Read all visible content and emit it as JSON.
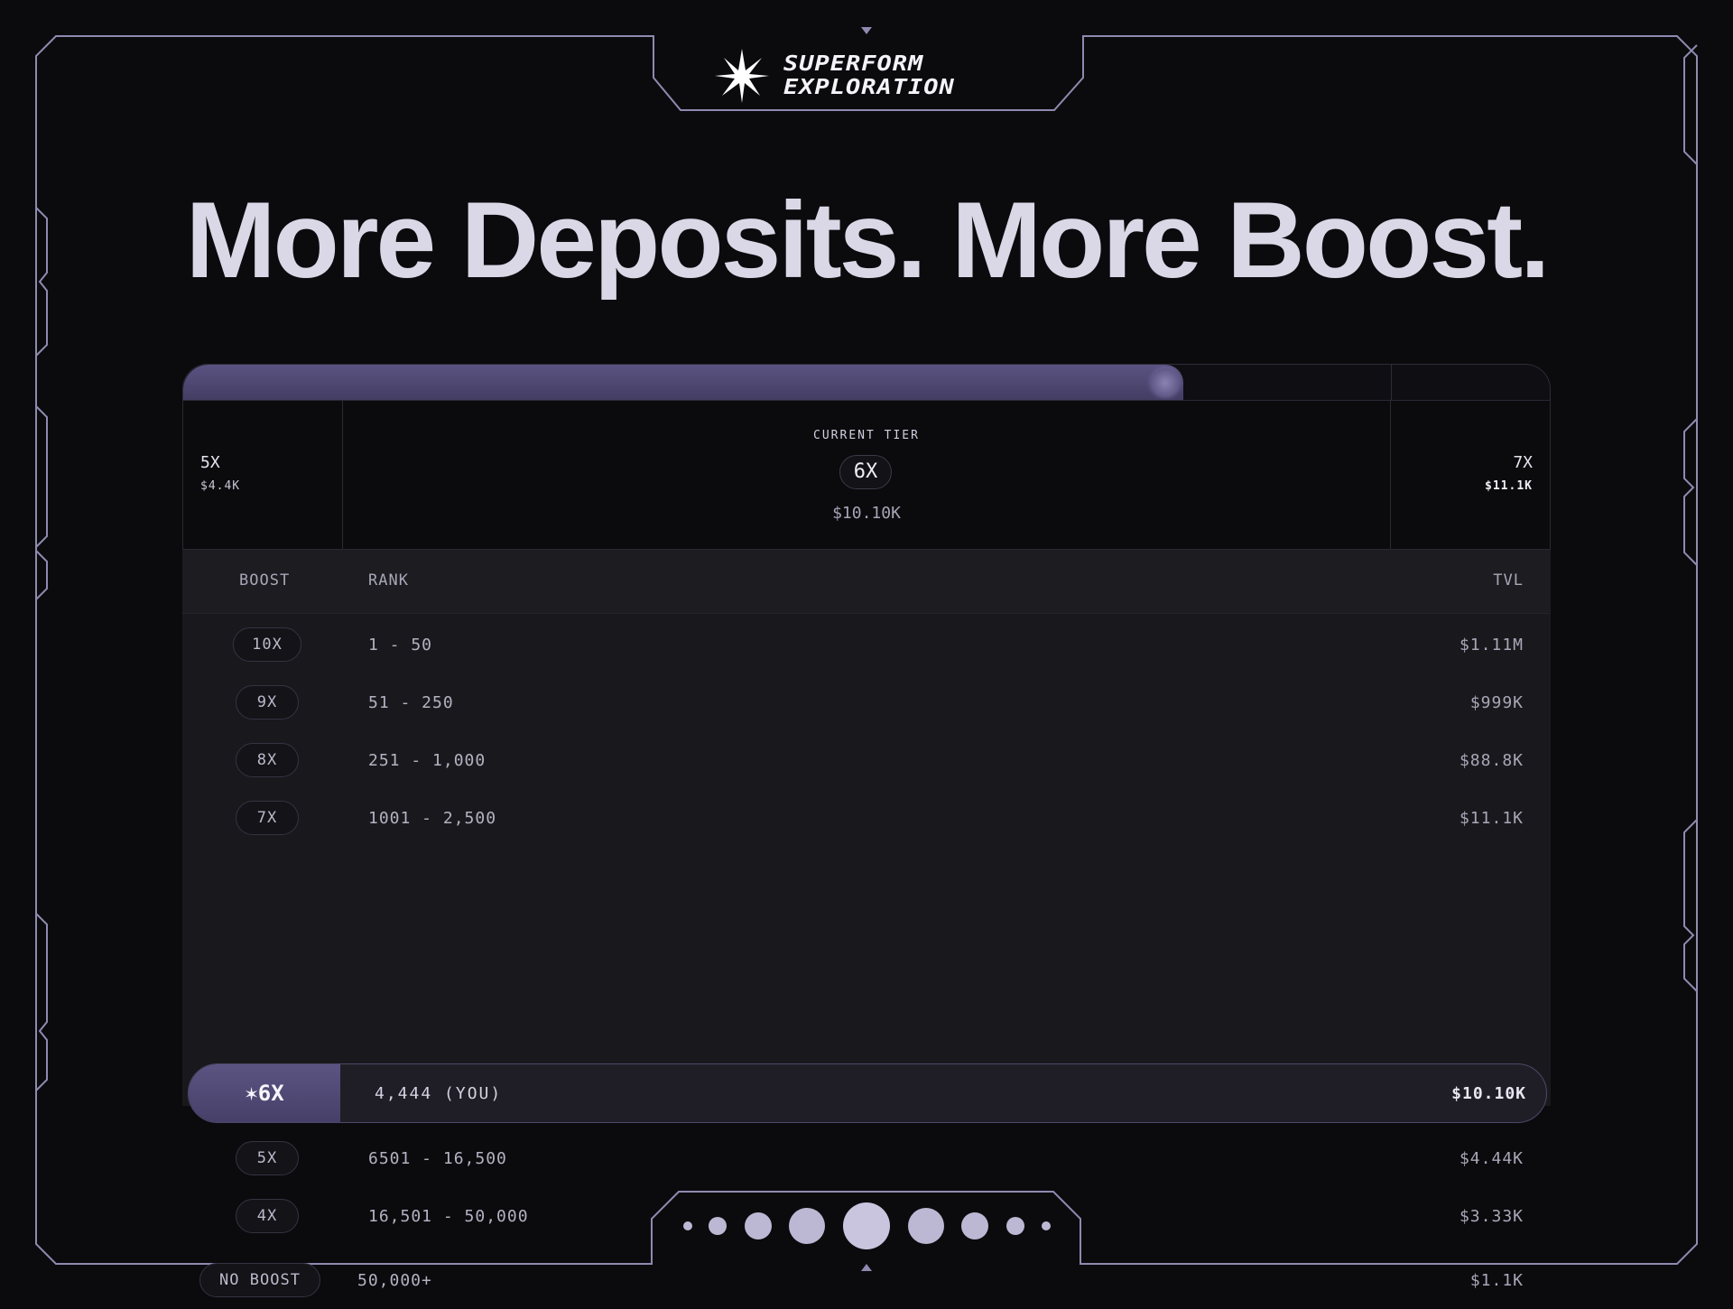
{
  "brand": {
    "line1": "SUPERFORM",
    "line2": "EXPLORATION"
  },
  "headline": "More Deposits. More Boost.",
  "progress": {
    "fill_fraction": 0.731
  },
  "tiers": {
    "previous": {
      "multiplier": "5X",
      "value": "$4.4K"
    },
    "current": {
      "label": "CURRENT TIER",
      "multiplier": "6X",
      "value": "$10.10K"
    },
    "next": {
      "multiplier": "7X",
      "value": "$11.1K"
    }
  },
  "table": {
    "headers": {
      "boost": "BOOST",
      "rank": "RANK",
      "tvl": "TVL"
    },
    "rows": [
      {
        "boost": "10X",
        "rank": "1 - 50",
        "tvl": "$1.11M"
      },
      {
        "boost": "9X",
        "rank": "51 - 250",
        "tvl": "$999K"
      },
      {
        "boost": "8X",
        "rank": "251 - 1,000",
        "tvl": "$88.8K"
      },
      {
        "boost": "7X",
        "rank": "1001 - 2,500",
        "tvl": "$11.1K"
      }
    ],
    "you": {
      "boost": "✶6X",
      "rank": "4,444 (YOU)",
      "tvl": "$10.10K"
    },
    "rows_after": [
      {
        "boost": "5X",
        "rank": "6501 - 16,500",
        "tvl": "$4.44K"
      },
      {
        "boost": "4X",
        "rank": "16,501 - 50,000",
        "tvl": "$3.33K"
      },
      {
        "boost": "NO BOOST",
        "rank": "50,000+",
        "tvl": "$1.1K"
      }
    ]
  },
  "pager": {
    "dots": 9,
    "active_index": 4
  },
  "colors": {
    "background": "#0b0b0e",
    "frame": "#8e8ab0",
    "accent": "#5b5482",
    "text": "#dad8e6"
  },
  "icons": {
    "logo": "sparkle-star-icon",
    "you_marker": "sparkle-icon"
  }
}
